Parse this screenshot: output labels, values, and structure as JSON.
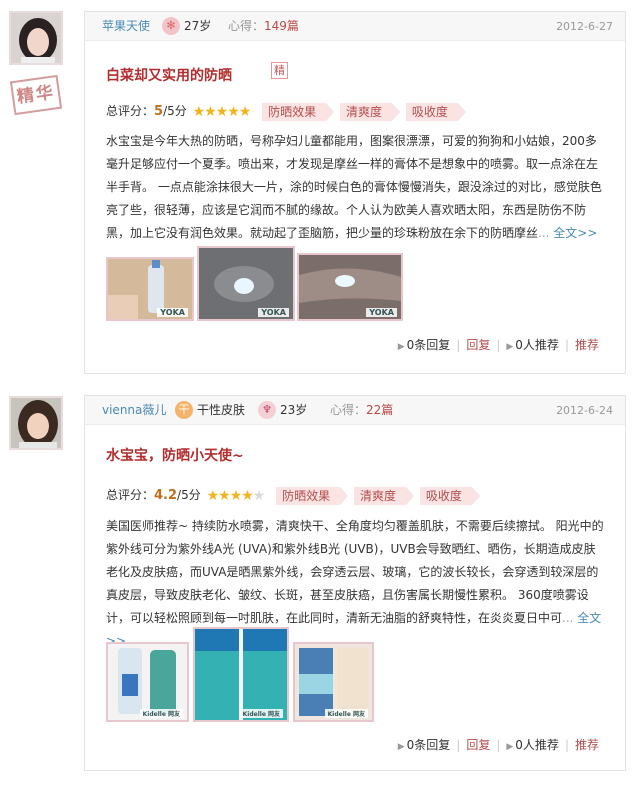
{
  "reviews": [
    {
      "username": "苹果天使",
      "age": "27岁",
      "xinde_label": "心得：",
      "xinde_count": "149篇",
      "date": "2012-6-27",
      "stamp": "精华",
      "title": "白菜却又实用的防晒",
      "title_badge": "精",
      "score_label": "总评分：",
      "score_value": "5",
      "score_suffix": "/5分",
      "stars": "★★★★★",
      "tags": [
        "防晒效果",
        "清爽度",
        "吸收度"
      ],
      "body": "水宝宝是今年大热的防晒，号称孕妇儿童都能用，图案很漂漂，可爱的狗狗和小姑娘，200多毫升足够应付一个夏季。喷出来，才发现是摩丝一样的膏体不是想象中的喷雾。取一点涂在左半手背。 一点点能涂抹很大一片，涂的时候白色的膏体慢慢消失，跟没涂过的对比，感觉肤色亮了些，很轻薄，应该是它润而不腻的缘故。个人认为欧美人喜欢晒太阳，东西是防伤不防黑，加上它没有润色效果。就动起了歪脑筋，把少量的珍珠粉放在余下的防晒摩丝",
      "ellipsis": "...",
      "more": "全文>>",
      "watermark": "YOKA",
      "actions": {
        "replies": "0条回复",
        "reply": "回复",
        "recommends": "0人推荐",
        "recommend": "推荐"
      }
    },
    {
      "username": "vienna薇儿",
      "skin_chip": "干",
      "skin": "干性皮肤",
      "age": "23岁",
      "xinde_label": "心得：",
      "xinde_count": "22篇",
      "date": "2012-6-24",
      "title": "水宝宝，防晒小天使~",
      "score_label": "总评分：",
      "score_value": "4.2",
      "score_suffix": "/5分",
      "stars_on": "★★★★",
      "stars_off": "★",
      "tags": [
        "防晒效果",
        "清爽度",
        "吸收度"
      ],
      "body": "美国医师推荐~ 持续防水喷雾，清爽快干、全角度均匀覆盖肌肤，不需要后续擦拭。 阳光中的紫外线可分为紫外线A光 (UVA)和紫外线B光 (UVB)，UVB会导致晒红、晒伤，长期造成皮肤老化及皮肤癌，而UVA是晒黑紫外线，会穿透云层、玻璃，它的波长较长，会穿透到较深层的真皮层，导致皮肤老化、皱纹、长斑，甚至皮肤癌，且伤害属长期慢性累积。 360度喷雾设计，可以轻松照顾到每一吋肌肤，在此同时，清新无油脂的舒爽特性，在炎炎夏日中可",
      "ellipsis": "...",
      "more": "全文>>",
      "thumb_caption": "Kidelle 网友",
      "actions": {
        "replies": "0条回复",
        "reply": "回复",
        "recommends": "0人推荐",
        "recommend": "推荐"
      }
    }
  ]
}
